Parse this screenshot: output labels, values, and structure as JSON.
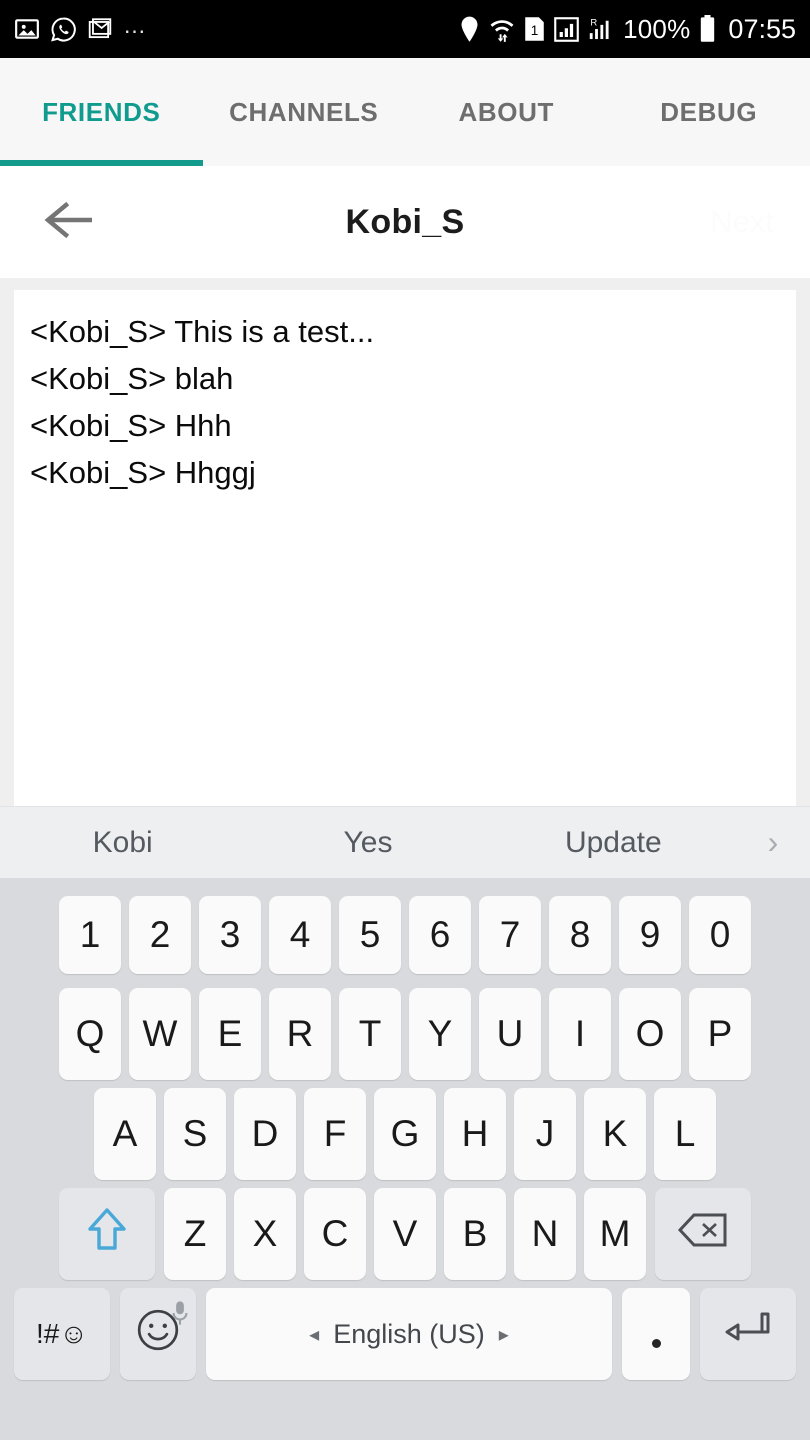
{
  "statusbar": {
    "left_icons": [
      "photos-icon",
      "whatsapp-icon",
      "gmail-icon"
    ],
    "overflow": "…",
    "right_icons": [
      "location-pin-icon",
      "wifi-icon",
      "sim-1-icon",
      "signal-box-icon",
      "roaming-signal-icon",
      "battery-icon"
    ],
    "battery_text": "100%",
    "time": "07:55"
  },
  "tabs": [
    {
      "label": "FRIENDS",
      "active": true
    },
    {
      "label": "CHANNELS",
      "active": false
    },
    {
      "label": "ABOUT",
      "active": false
    },
    {
      "label": "DEBUG",
      "active": false
    }
  ],
  "header": {
    "back_icon": "back-arrow-icon",
    "title": "Kobi_S",
    "next_label": "Next"
  },
  "messages": [
    "<Kobi_S> This is a test...",
    "<Kobi_S> blah",
    "<Kobi_S> Hhh",
    "<Kobi_S> Hhggj"
  ],
  "suggestions": {
    "items": [
      "Kobi",
      "Yes",
      "Update"
    ],
    "expand_icon": "›"
  },
  "keyboard": {
    "row_numbers": [
      "1",
      "2",
      "3",
      "4",
      "5",
      "6",
      "7",
      "8",
      "9",
      "0"
    ],
    "row_q": [
      "Q",
      "W",
      "E",
      "R",
      "T",
      "Y",
      "U",
      "I",
      "O",
      "P"
    ],
    "row_a": [
      "A",
      "S",
      "D",
      "F",
      "G",
      "H",
      "J",
      "K",
      "L"
    ],
    "row_z": [
      "Z",
      "X",
      "C",
      "V",
      "B",
      "N",
      "M"
    ],
    "shift_icon": "shift-arrow-icon",
    "backspace_icon": "backspace-icon",
    "symbols_label": "!#☺",
    "emoji_icon": "emoji-smiley-icon",
    "mic_icon": "microphone-icon",
    "space_label": "English (US)",
    "space_prev_icon": "◂",
    "space_next_icon": "▸",
    "period_label": ".",
    "enter_icon": "enter-return-icon"
  },
  "colors": {
    "accent_teal": "#129b8d",
    "statusbar_bg": "#000000",
    "tabbar_bg": "#f7f7f7",
    "keyboard_bg": "#d8dadd",
    "key_bg": "#fafafa",
    "key_gray_bg": "#e4e6e9",
    "shift_blue": "#4aa8d8",
    "suggestion_bg": "#eeeff1"
  }
}
